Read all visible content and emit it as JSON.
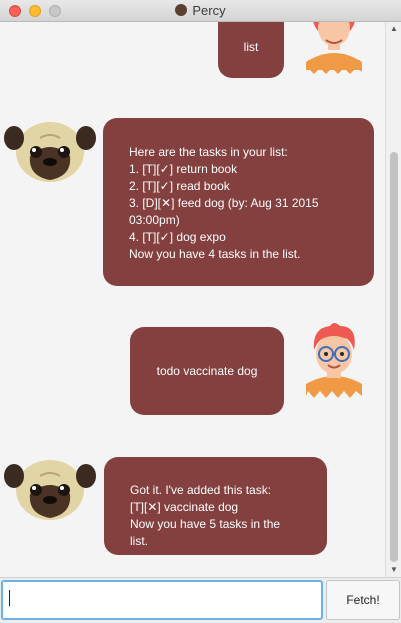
{
  "window": {
    "title": "Percy",
    "close_icon": "close-icon",
    "minimize_icon": "minimize-icon",
    "maximize_icon": "maximize-icon"
  },
  "messages": [
    {
      "sender": "user",
      "text": "list"
    },
    {
      "sender": "bot",
      "text": "Here are the tasks in your list:\n1. [T][✓] return book\n2. [T][✓] read book\n3. [D][✕] feed dog (by: Aug 31 2015\n03:00pm)\n4. [T][✓] dog expo\nNow you have 4 tasks in the list."
    },
    {
      "sender": "user",
      "text": "todo vaccinate dog"
    },
    {
      "sender": "bot",
      "text": "Got it. I've added this task:\n[T][✕] vaccinate dog\nNow you have 5 tasks in the list."
    }
  ],
  "input": {
    "value": "",
    "placeholder": ""
  },
  "send_button": {
    "label": "Fetch!"
  },
  "colors": {
    "bubble": "#843f3f",
    "bubble_text": "#ffffff",
    "focus": "#6cb1e8"
  },
  "icons": {
    "bot_avatar": "pug-avatar-icon",
    "user_avatar": "user-avatar-icon"
  }
}
